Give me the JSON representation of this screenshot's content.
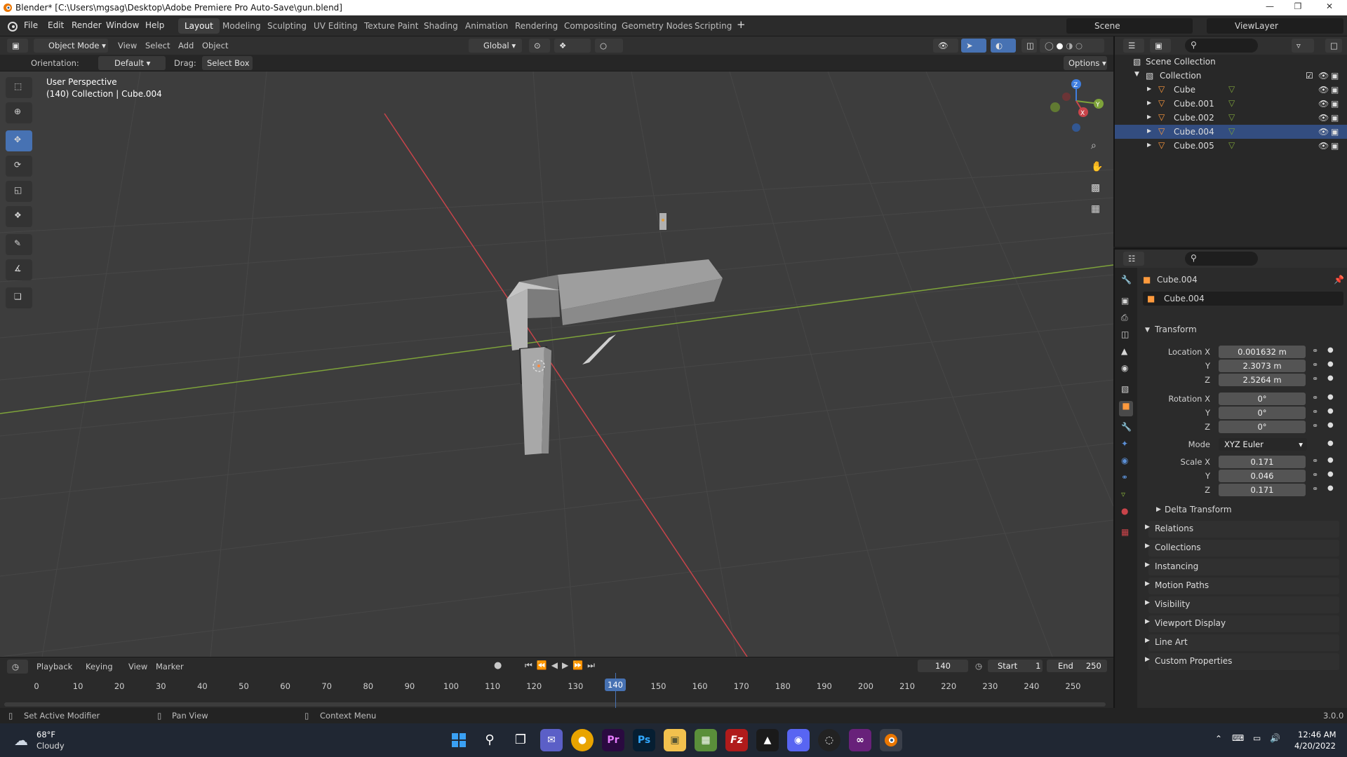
{
  "window": {
    "title": "Blender* [C:\\Users\\mgsag\\Desktop\\Adobe Premiere Pro Auto-Save\\gun.blend]"
  },
  "menu": [
    "File",
    "Edit",
    "Render",
    "Window",
    "Help"
  ],
  "workspaces": [
    "Layout",
    "Modeling",
    "Sculpting",
    "UV Editing",
    "Texture Paint",
    "Shading",
    "Animation",
    "Rendering",
    "Compositing",
    "Geometry Nodes",
    "Scripting"
  ],
  "scene_name": "Scene",
  "viewlayer_name": "ViewLayer",
  "header3d": {
    "mode": "Object Mode",
    "menus": [
      "View",
      "Select",
      "Add",
      "Object"
    ],
    "transform_orientation": "Global"
  },
  "toolsettings": {
    "orientation_label": "Orientation:",
    "orientation_value": "Default",
    "drag_label": "Drag:",
    "drag_value": "Select Box",
    "options": "Options"
  },
  "viewport": {
    "view_name": "User Perspective",
    "info": "(140) Collection | Cube.004",
    "axes": {
      "x": "X",
      "y": "Y",
      "z": "Z"
    }
  },
  "outliner": {
    "scene_collection": "Scene Collection",
    "collection": "Collection",
    "objects": [
      "Cube",
      "Cube.001",
      "Cube.002",
      "Cube.004",
      "Cube.005"
    ]
  },
  "properties": {
    "object_name": "Cube.004",
    "datablock": "Cube.004",
    "transform_title": "Transform",
    "location": {
      "label_x": "Location X",
      "x": "0.001632 m",
      "y": "2.3073 m",
      "z": "2.5264 m"
    },
    "rotation": {
      "label_x": "Rotation X",
      "x": "0°",
      "y": "0°",
      "z": "0°"
    },
    "mode": {
      "label": "Mode",
      "value": "XYZ Euler"
    },
    "scale": {
      "label_x": "Scale X",
      "x": "0.171",
      "y": "0.046",
      "z": "0.171"
    },
    "axis_y": "Y",
    "axis_z": "Z",
    "delta": "Delta Transform",
    "panels": [
      "Relations",
      "Collections",
      "Instancing",
      "Motion Paths",
      "Visibility",
      "Viewport Display",
      "Line Art",
      "Custom Properties"
    ]
  },
  "timeline": {
    "menus": [
      "Playback",
      "Keying",
      "View",
      "Marker"
    ],
    "current_frame": "140",
    "start_label": "Start",
    "start": "1",
    "end_label": "End",
    "end": "250",
    "ticks": [
      "0",
      "10",
      "20",
      "30",
      "40",
      "50",
      "60",
      "70",
      "80",
      "90",
      "100",
      "110",
      "120",
      "130",
      "140",
      "150",
      "160",
      "170",
      "180",
      "190",
      "200",
      "210",
      "220",
      "230",
      "240",
      "250"
    ]
  },
  "status": {
    "left": "Set Active Modifier",
    "middle": "Pan View",
    "right": "Context Menu",
    "version": "3.0.0"
  },
  "taskbar": {
    "temp": "68°F",
    "weather": "Cloudy",
    "time": "12:46 AM",
    "date": "4/20/2022"
  },
  "colors": {
    "accent": "#4772b3",
    "frame_marker": "#4772b3",
    "x_axis": "#c9444a",
    "y_axis": "#7ea33a",
    "z_axis": "#3f7ee0"
  }
}
